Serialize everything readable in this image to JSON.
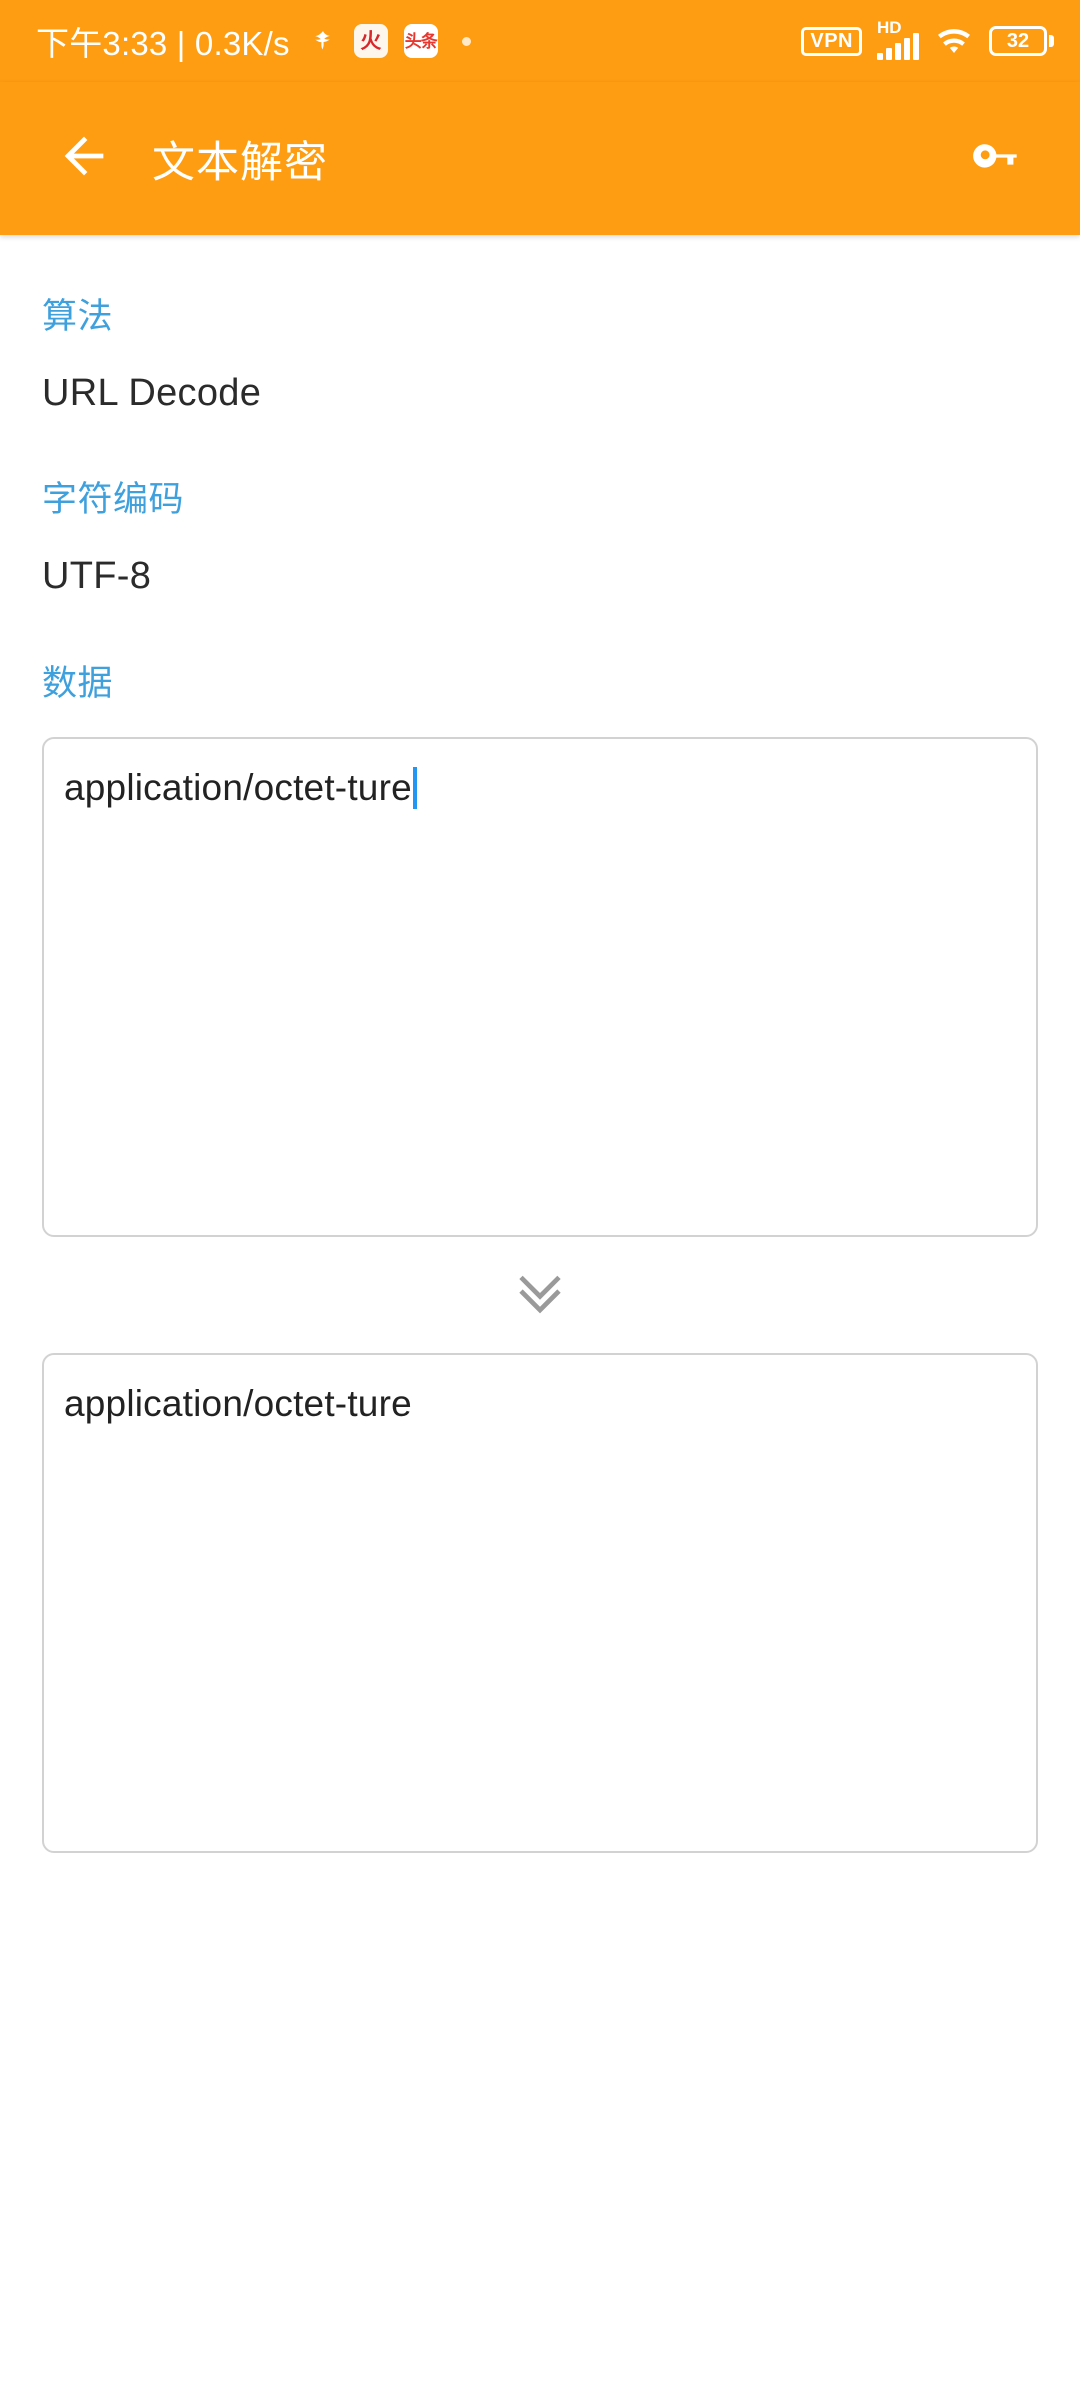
{
  "status_bar": {
    "clock": "下午3:33 | 0.3K/s",
    "notification_icons": [
      {
        "name": "bird-notification-icon",
        "label": ""
      },
      {
        "name": "app-notification-icon",
        "label": "火"
      },
      {
        "name": "toutiao-notification-icon",
        "label": "头条"
      }
    ],
    "vpn_label": "VPN",
    "hd_label": "HD",
    "signal_bars": 5,
    "battery_level": "32",
    "background_color": "#FF9D12",
    "foreground_color": "#FFFFFF"
  },
  "app_bar": {
    "title": "文本解密",
    "back_icon": "arrow-left-icon",
    "action_icon": "key-icon",
    "background_color": "#FF9D12"
  },
  "form": {
    "label_color": "#3FA0DE",
    "algorithm": {
      "label": "算法",
      "value": "URL Decode"
    },
    "encoding": {
      "label": "字符编码",
      "value": "UTF-8"
    },
    "data": {
      "label": "数据",
      "input_value": "application/octet-ture",
      "input_placeholder": "",
      "caret_color": "#2196F3"
    },
    "divider_icon": "double-chevron-down-icon",
    "result": {
      "value": "application/octet-ture",
      "placeholder": ""
    }
  }
}
